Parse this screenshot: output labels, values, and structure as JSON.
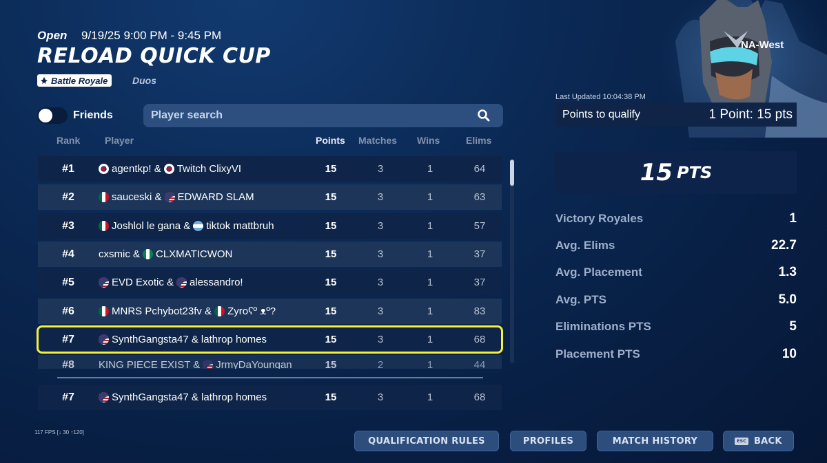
{
  "event": {
    "status": "Open",
    "datetime": "9/19/25 9:00 PM - 9:45 PM",
    "title": "RELOAD QUICK CUP",
    "mode": "Battle Royale",
    "team_size": "Duos"
  },
  "filters": {
    "friends_label": "Friends",
    "friends_toggle_on": false,
    "search_placeholder": "Player search"
  },
  "columns": [
    "Rank",
    "Player",
    "Points",
    "Matches",
    "Wins",
    "Elims"
  ],
  "rows": [
    {
      "rank": "#1",
      "p1": "agentkp!",
      "p2": "Twitch ClixyVI",
      "f1": "kr",
      "f2": "kr",
      "points": "15",
      "matches": "3",
      "wins": "1",
      "elims": "64"
    },
    {
      "rank": "#2",
      "p1": "sauceski",
      "p2": "EDWARD SLAM",
      "f1": "mx",
      "f2": "us",
      "points": "15",
      "matches": "3",
      "wins": "1",
      "elims": "63"
    },
    {
      "rank": "#3",
      "p1": "Joshlol le gana",
      "p2": "tiktok mattbruh",
      "f1": "mx",
      "f2": "ar",
      "points": "15",
      "matches": "3",
      "wins": "1",
      "elims": "57"
    },
    {
      "rank": "#4",
      "p1": "cxsmic",
      "p2": "CLXMATICWON",
      "f1": "",
      "f2": "ng",
      "points": "15",
      "matches": "3",
      "wins": "1",
      "elims": "37"
    },
    {
      "rank": "#5",
      "p1": "EVD Exotic",
      "p2": "alessandro!",
      "f1": "us",
      "f2": "us",
      "points": "15",
      "matches": "3",
      "wins": "1",
      "elims": "37"
    },
    {
      "rank": "#6",
      "p1": "MNRS Pchybot23fv",
      "p2": "Zyroʕº ᴥº?",
      "f1": "mx",
      "f2": "mx",
      "points": "15",
      "matches": "3",
      "wins": "1",
      "elims": "83"
    },
    {
      "rank": "#7",
      "p1": "SynthGangsta47",
      "p2": "lathrop homes",
      "f1": "us",
      "f2": "",
      "points": "15",
      "matches": "3",
      "wins": "1",
      "elims": "68",
      "selected": true
    },
    {
      "rank": "#8",
      "p1": "KING PIECE EXIST",
      "p2": "JrmyDaYoungan",
      "f1": "",
      "f2": "us",
      "points": "15",
      "matches": "2",
      "wins": "1",
      "elims": "44"
    }
  ],
  "my_row": {
    "rank": "#7",
    "p1": "SynthGangsta47",
    "p2": "lathrop homes",
    "f1": "us",
    "points": "15",
    "matches": "3",
    "wins": "1",
    "elims": "68"
  },
  "panel": {
    "region": "NA-West",
    "last_updated": "Last Updated 10:04:38 PM",
    "qualify_label": "Points to qualify",
    "qualify_value": "1 Point: 15 pts",
    "total_points": "15",
    "total_points_unit": "PTS",
    "stats": [
      {
        "label": "Victory Royales",
        "value": "1"
      },
      {
        "label": "Avg. Elims",
        "value": "22.7"
      },
      {
        "label": "Avg. Placement",
        "value": "1.3"
      },
      {
        "label": "Avg. PTS",
        "value": "5.0"
      },
      {
        "label": "Eliminations PTS",
        "value": "5"
      },
      {
        "label": "Placement PTS",
        "value": "10"
      }
    ]
  },
  "fps": "117 FPS [↓ 30 ↑120]",
  "buttons": {
    "qualification_rules": "QUALIFICATION RULES",
    "profiles": "PROFILES",
    "match_history": "MATCH HISTORY",
    "back": "BACK",
    "back_key": "ESC"
  },
  "colors": {
    "selected_outline": "#f5f03a",
    "row_dark": "#0e2448",
    "row_light": "#1c3558"
  }
}
